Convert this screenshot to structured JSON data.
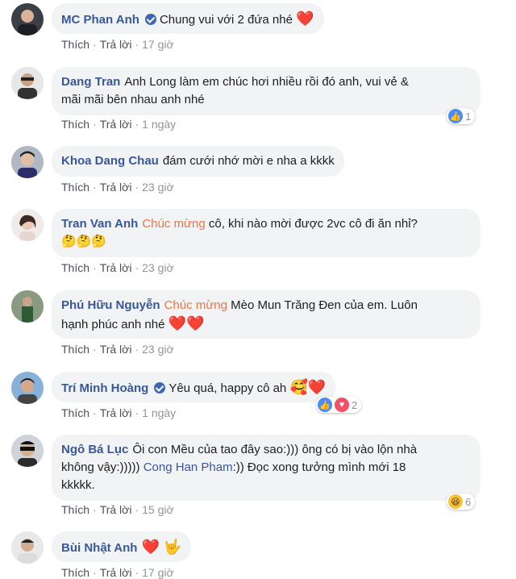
{
  "comments": [
    {
      "author": "MC Phan Anh",
      "verified": true,
      "text": "Chung vui với 2 đứa nhé",
      "emoji": "❤️",
      "like": "Thích",
      "reply": "Trả lời",
      "time": "17 giờ"
    },
    {
      "author": "Dang Tran",
      "text_line1": "Anh Long làm em chúc hơi nhiều rồi đó anh, vui vẻ &",
      "text_line2": "mãi mãi bên nhau anh nhé",
      "like": "Thích",
      "reply": "Trả lời",
      "time": "1 ngày",
      "reaction_count": "1"
    },
    {
      "author": "Khoa Dang Chau",
      "text": "đám cưới nhớ mời e nha a kkkk",
      "like": "Thích",
      "reply": "Trả lời",
      "time": "23 giờ"
    },
    {
      "author": "Tran Van Anh",
      "highlight": "Chúc mừng",
      "text": "cô, khi nào mời được 2vc cô đi ăn nhỉ?",
      "emoji_line": "🤔🤔🤔",
      "like": "Thích",
      "reply": "Trả lời",
      "time": "23 giờ"
    },
    {
      "author": "Phú Hữu Nguyễn",
      "highlight": "Chúc mừng",
      "text_line1": "Mèo Mun Trăng Đen của em. Luôn",
      "text_line2": "hạnh phúc anh nhé",
      "emoji": "❤️❤️",
      "like": "Thích",
      "reply": "Trả lời",
      "time": "23 giờ"
    },
    {
      "author": "Trí Minh Hoàng",
      "verified": true,
      "text": "Yêu quá, happy cô ah",
      "emoji": "🥰❤️",
      "like": "Thích",
      "reply": "Trả lời",
      "time": "1 ngày",
      "reaction_count": "2"
    },
    {
      "author": "Ngô Bá Lục",
      "text_line1": "Ôi con Mều của tao đây sao:))) ông có bị vào lộn nhà",
      "text_line2a": "không vậy:)))))",
      "mention": "Cong Han Pham",
      "text_line2b": ":)) Đọc xong tưởng mình mới 18",
      "text_line3": "kkkkk.",
      "like": "Thích",
      "reply": "Trả lời",
      "time": "15 giờ",
      "reaction_count": "6"
    },
    {
      "author": "Bùi Nhật Anh",
      "emoji": "❤️ 🤟",
      "like": "Thích",
      "reply": "Trả lời",
      "time": "17 giờ"
    }
  ],
  "colors": {
    "author": "#385898",
    "bubble": "#f2f3f5",
    "highlight": "#e8764a",
    "meta": "#90949c"
  }
}
